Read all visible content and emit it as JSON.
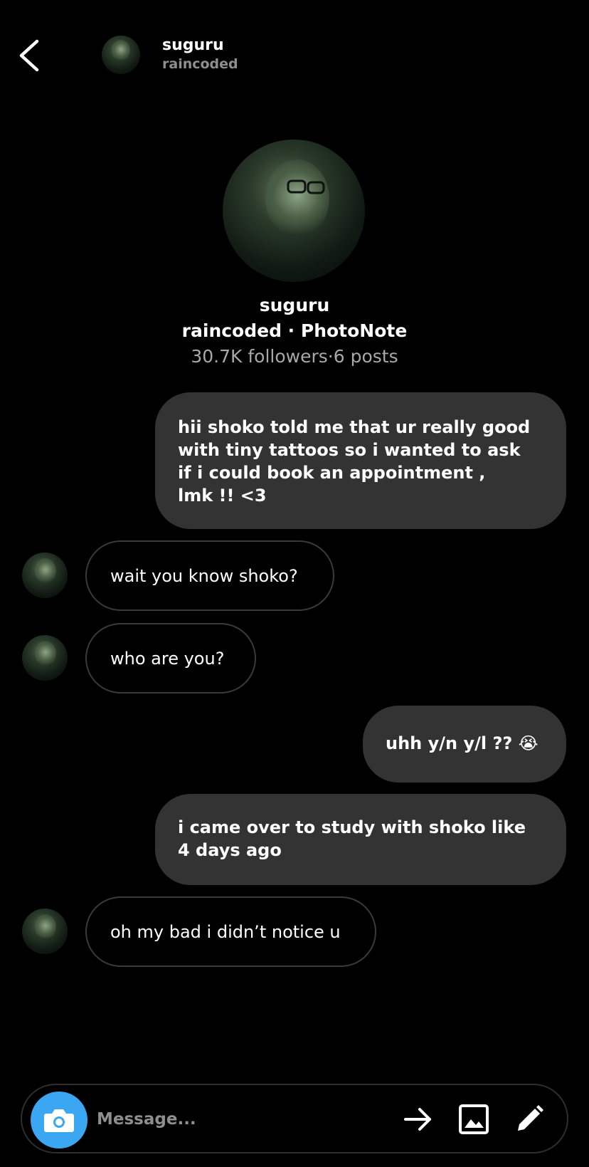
{
  "header": {
    "name": "suguru",
    "handle": "raincoded"
  },
  "profile": {
    "name": "suguru",
    "handle_line": "raincoded  · PhotoNote",
    "stats": "30.7K followers·6 posts"
  },
  "messages": [
    {
      "from": "me",
      "lines": [
        "hii shoko told me that ur really good",
        "with tiny tattoos so i wanted to ask",
        "if i could book an appointment ,",
        "lmk !! <3"
      ]
    },
    {
      "from": "them",
      "text": "wait you know shoko?"
    },
    {
      "from": "them",
      "text": "who are you?"
    },
    {
      "from": "me",
      "lines": [
        "uhh y/n y/l ?? 😭"
      ]
    },
    {
      "from": "me",
      "lines": [
        "i came over to study with shoko like",
        "4 days ago"
      ]
    },
    {
      "from": "them",
      "text": "oh my bad i didn’t notice u"
    }
  ],
  "composer": {
    "placeholder": "Message..."
  },
  "icons": {
    "back": "chevron-left-icon",
    "camera": "camera-icon",
    "send": "arrow-right-icon",
    "gallery": "image-icon",
    "sticker": "pencil-icon"
  },
  "colors": {
    "background": "#000000",
    "sent_bubble": "#333333",
    "received_border": "#3a3a3a",
    "camera_accent": "#3ba6f2",
    "muted_text": "#a8a8a8"
  }
}
